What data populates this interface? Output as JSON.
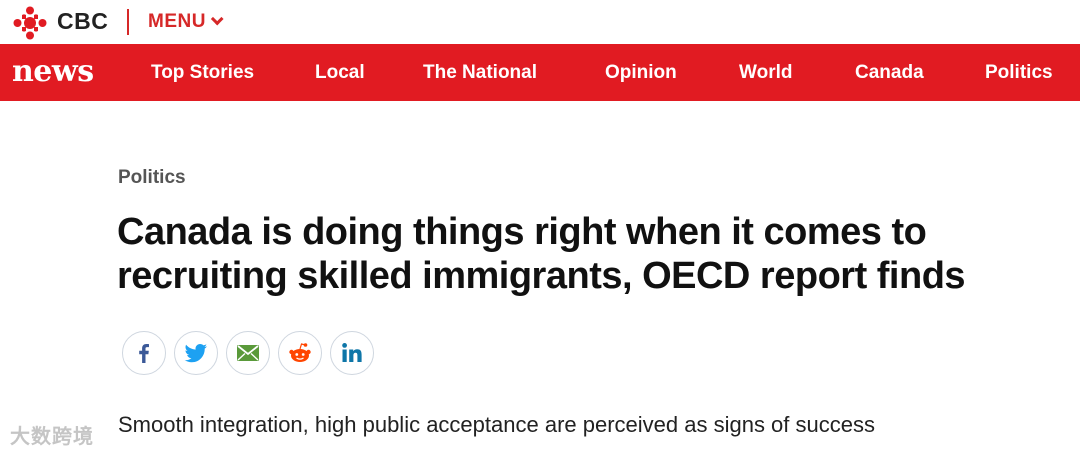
{
  "header": {
    "brand": "CBC",
    "menu_label": "MENU"
  },
  "nav": {
    "logo": "news",
    "items": [
      {
        "label": "Top Stories"
      },
      {
        "label": "Local"
      },
      {
        "label": "The National"
      },
      {
        "label": "Opinion"
      },
      {
        "label": "World"
      },
      {
        "label": "Canada"
      },
      {
        "label": "Politics"
      }
    ]
  },
  "article": {
    "section": "Politics",
    "headline_line1": "Canada is doing things right when it comes to",
    "headline_line2": "recruiting skilled immigrants, OECD report finds",
    "deck": "Smooth integration, high public acceptance are perceived as signs of success",
    "share": [
      "facebook-icon",
      "twitter-icon",
      "email-icon",
      "reddit-icon",
      "linkedin-icon"
    ]
  },
  "watermark": "大数跨境",
  "colors": {
    "brand_red": "#e11b22",
    "share_border": "#cfd6df",
    "facebook": "#3b5998",
    "twitter": "#1da1f2",
    "email": "#5a9a3a",
    "reddit": "#ff4500",
    "linkedin": "#0e76a8"
  }
}
